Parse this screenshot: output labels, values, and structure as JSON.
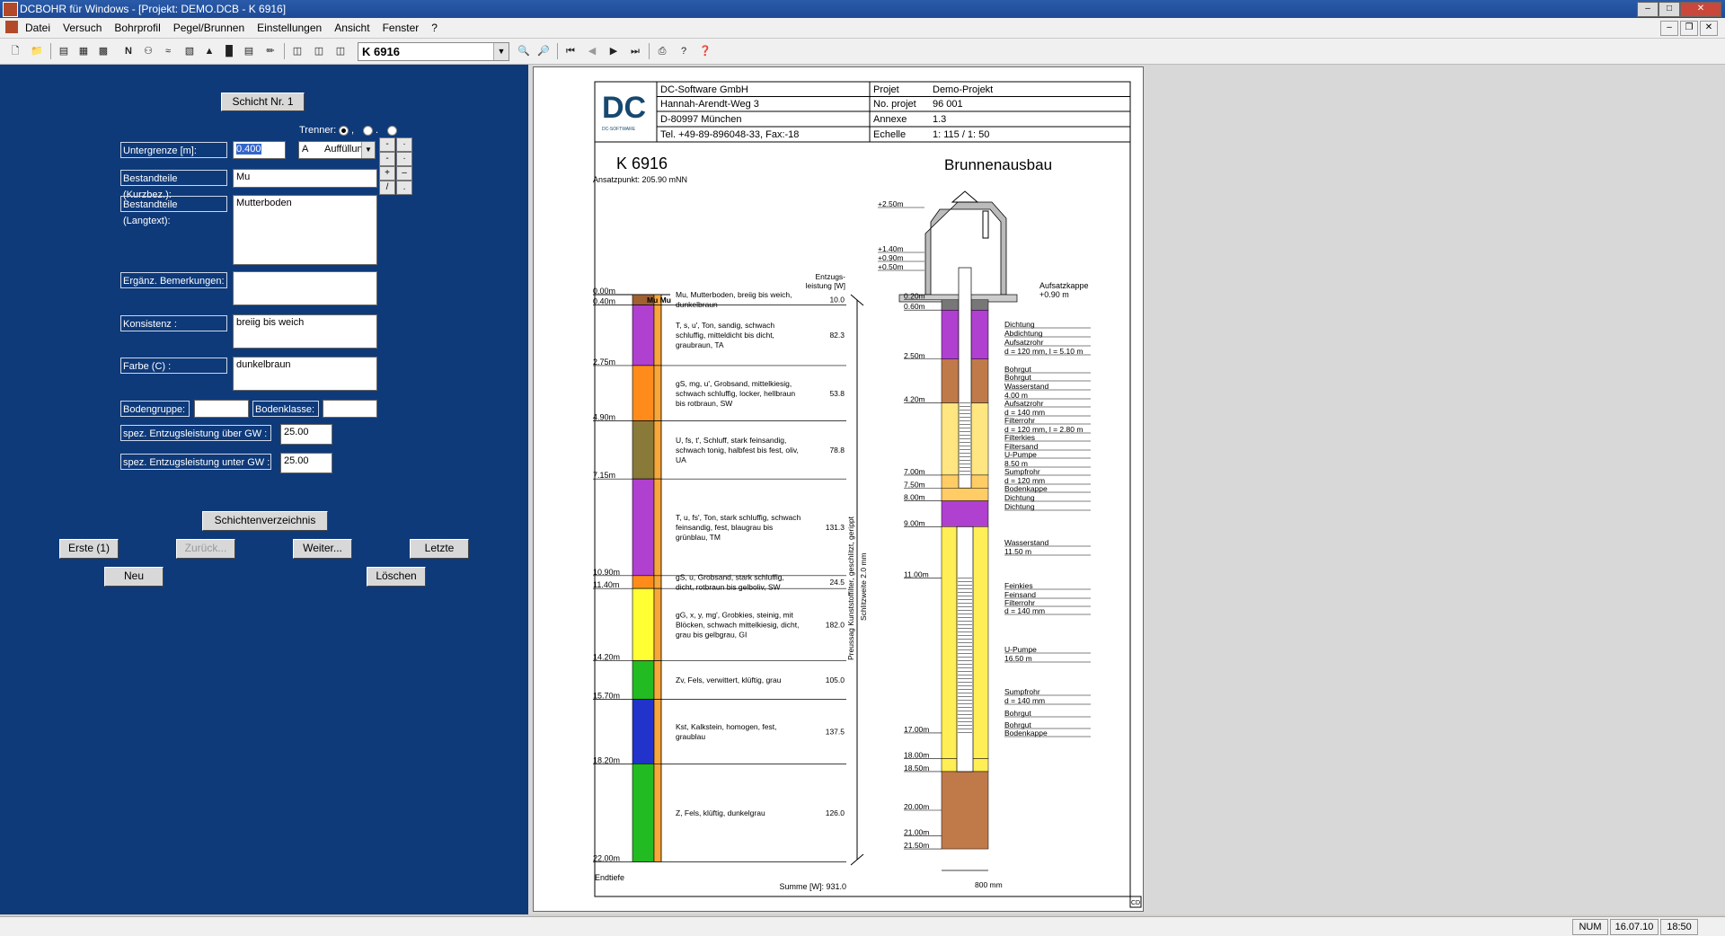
{
  "window": {
    "title": "DCBOHR für Windows - [Projekt: DEMO.DCB - K 6916]"
  },
  "menu": [
    "Datei",
    "Versuch",
    "Bohrprofil",
    "Pegel/Brunnen",
    "Einstellungen",
    "Ansicht",
    "Fenster",
    "?"
  ],
  "toolbar": {
    "combo_value": "K 6916",
    "n_label": "N"
  },
  "form": {
    "schicht_label": "Schicht Nr.  1",
    "trenner_label": "Trenner:",
    "trenner_opts": [
      ",",
      ".",
      "_"
    ],
    "untergrenze_label": "Untergrenze          [m]:",
    "untergrenze_value": "0.400",
    "code_value": "A",
    "auffuellung_value": "Auffüllun",
    "kurzbez_label": "Bestandteile (Kurzbez.):",
    "kurzbez_value": "Mu",
    "langtext_label": "Bestandteile (Langtext):",
    "langtext_value": "Mutterboden",
    "bemerkungen_label": "Ergänz. Bemerkungen:",
    "bemerkungen_value": "",
    "konsistenz_label": "Konsistenz               :",
    "konsistenz_value": "breiig bis weich",
    "farbe_label": "Farbe (C)               :",
    "farbe_value": "dunkelbraun",
    "bodengruppe_label": "Bodengruppe:",
    "bodenklasse_label": "Bodenklasse:",
    "entzug_ueber_label": "spez. Entzugsleistung über GW  :",
    "entzug_ueber_value": "25.00",
    "entzug_unter_label": "spez. Entzugsleistung unter GW :",
    "entzug_unter_value": "25.00",
    "buttons": {
      "schichten": "Schichtenverzeichnis",
      "erste": "Erste (1)",
      "zurueck": "Zurück...",
      "weiter": "Weiter...",
      "letzte": "Letzte",
      "neu": "Neu",
      "loeschen": "Löschen"
    }
  },
  "sheet": {
    "company": [
      "DC-Software GmbH",
      "Hannah-Arendt-Weg 3",
      "D-80997 München",
      "Tel. +49-89-896048-33, Fax:-18"
    ],
    "logo_text": "DC",
    "logo_sub": "DC-SOFTWARE",
    "info_labels": [
      "Projet",
      "No. projet",
      "Annexe",
      "Echelle"
    ],
    "info_values": [
      "Demo-Projekt",
      "96 001",
      "1.3",
      "1: 115 / 1: 50"
    ],
    "bore_name": "K 6916",
    "ansatzpunkt": "Ansatzpunkt: 205.90 mNN",
    "well_title": "Brunnenausbau",
    "entzug_header": [
      "Entzugs-",
      "leistung [W]"
    ],
    "top_depth": "0.00m",
    "mu_label": "Mu Mu",
    "end_label": "Endtiefe",
    "summe": "Summe [W]:  931.0",
    "pump_label": "Preussag Kunststoffilter, geschlitzt, gerippt",
    "slit_label": "Schlitzweite 2.0 mm",
    "diam_label": "800 mm",
    "layers": [
      {
        "depth": "0.40m",
        "lines": [
          "Mu, Mutterboden, breiig bis weich,",
          "dunkelbraun"
        ],
        "value": "10.0",
        "color": "#a06030"
      },
      {
        "depth": "2.75m",
        "lines": [
          "T, s, u', Ton, sandig, schwach",
          "schluffig, mitteldicht bis dicht,",
          "graubraun, TA"
        ],
        "value": "82.3",
        "color": "#b040d0"
      },
      {
        "depth": "4.90m",
        "lines": [
          "gS, mg, u', Grobsand, mittelkiesig,",
          "schwach schluffig, locker, hellbraun",
          "bis rotbraun, SW"
        ],
        "value": "53.8",
        "color": "#ff8c1a"
      },
      {
        "depth": "7.15m",
        "lines": [
          "U, fs, t', Schluff, stark feinsandig,",
          "schwach tonig, halbfest bis fest, oliv,",
          "UA"
        ],
        "value": "78.8",
        "color": "#8a7a3a"
      },
      {
        "depth": "10.90m",
        "lines": [
          "T, u, fs', Ton, stark schluffig, schwach",
          "feinsandig, fest, blaugrau bis",
          "grünblau, TM"
        ],
        "value": "131.3",
        "color": "#b040d0"
      },
      {
        "depth": "11.40m",
        "lines": [
          "gS, u, Grobsand, stark schluffig,",
          "dicht, rotbraun bis gelboliv, SW"
        ],
        "value": "24.5",
        "color": "#ff8c1a"
      },
      {
        "depth": "14.20m",
        "lines": [
          "gG, x, y, mg', Grobkies, steinig, mit",
          "Blöcken, schwach mittelkiesig, dicht,",
          "grau bis gelbgrau, GI"
        ],
        "value": "182.0",
        "color": "#ffff33"
      },
      {
        "depth": "15.70m",
        "lines": [
          "Zv, Fels, verwittert, klüftig, grau"
        ],
        "value": "105.0",
        "color": "#22bb22"
      },
      {
        "depth": "18.20m",
        "lines": [
          "Kst, Kalkstein, homogen, fest,",
          "graublau"
        ],
        "value": "137.5",
        "color": "#2233cc"
      },
      {
        "depth": "22.00m",
        "lines": [
          "Z, Fels, klüftig, dunkelgrau"
        ],
        "value": "126.0",
        "color": "#22bb22"
      }
    ],
    "well_top_labels": [
      "+2.50m",
      "+1.40m",
      "+0.90m",
      "+0.50m"
    ],
    "aufsatzkappe": [
      "Aufsatzkappe",
      "+0.90 m"
    ],
    "well_depths": [
      "0.20m",
      "0.60m",
      "2.50m",
      "4.20m",
      "7.00m",
      "7.50m",
      "8.00m",
      "9.00m",
      "11.00m",
      "17.00m",
      "18.00m",
      "18.50m",
      "20.00m",
      "21.00m",
      "21.50m"
    ],
    "well_notes": [
      "Dichtung",
      "Abdichtung",
      "Aufsatzrohr",
      "d = 120 mm, l  = 5.10 m",
      "Bohrgut",
      "Bohrgut",
      "Wasserstand",
      "4.00 m",
      "Aufsatzrohr",
      "d = 140 mm",
      "Filterrohr",
      "d = 120 mm, l  = 2.80 m",
      "Filterkies",
      "Filtersand",
      "U-Pumpe",
      "8.50 m",
      "Sumpfrohr",
      "d = 120 mm",
      "Bodenkappe",
      "Dichtung",
      "Dichtung",
      "Wasserstand",
      "11.50 m",
      "Feinkies",
      "Feinsand",
      "Filterrohr",
      "d = 140 mm",
      "U-Pumpe",
      "16.50 m",
      "Sumpfrohr",
      "d = 140 mm",
      "Bohrgut",
      "Bohrgut",
      "Bodenkappe"
    ],
    "corner_label": "CD"
  },
  "status": {
    "num": "NUM",
    "date": "16.07.10",
    "time": "18:50"
  }
}
